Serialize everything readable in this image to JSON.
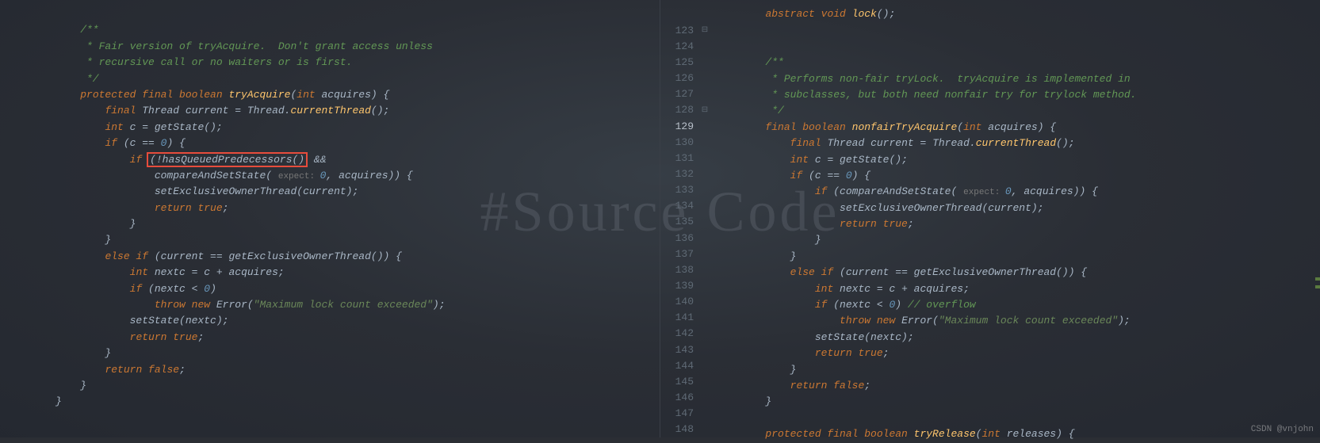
{
  "watermark": "#Source Code",
  "credit": "CSDN @vnjohn",
  "leftPane": {
    "start_line_visible": false,
    "comment": [
      "/**",
      " * Fair version of tryAcquire.  Don't grant access unless",
      " * recursive call or no waiters or is first.",
      " */"
    ],
    "lines": [
      {
        "tokens": [
          [
            "kw",
            "protected final boolean "
          ],
          [
            "method",
            "tryAcquire"
          ],
          [
            "ident",
            "("
          ],
          [
            "kw",
            "int"
          ],
          [
            "ident",
            " acquires) {"
          ]
        ]
      },
      {
        "tokens": [
          [
            "ident",
            "    "
          ],
          [
            "kw",
            "final"
          ],
          [
            "ident",
            " Thread current = Thread."
          ],
          [
            "method",
            "currentThread"
          ],
          [
            "ident",
            "();"
          ]
        ]
      },
      {
        "tokens": [
          [
            "ident",
            "    "
          ],
          [
            "kw",
            "int"
          ],
          [
            "ident",
            " c = getState();"
          ]
        ]
      },
      {
        "tokens": [
          [
            "ident",
            "    "
          ],
          [
            "kw",
            "if"
          ],
          [
            "ident",
            " (c == "
          ],
          [
            "num",
            "0"
          ],
          [
            "ident",
            ") {"
          ]
        ]
      },
      {
        "highlight": true,
        "tokens": [
          [
            "ident",
            "        "
          ],
          [
            "kw",
            "if"
          ],
          [
            "ident",
            " "
          ],
          [
            "redbox",
            "(!hasQueuedPredecessors()"
          ],
          [
            "ident",
            " &&"
          ]
        ]
      },
      {
        "tokens": [
          [
            "ident",
            "            compareAndSetState( "
          ],
          [
            "hint",
            "expect: "
          ],
          [
            "num",
            "0"
          ],
          [
            "ident",
            ", acquires)) {"
          ]
        ]
      },
      {
        "tokens": [
          [
            "ident",
            "            setExclusiveOwnerThread(current);"
          ]
        ]
      },
      {
        "tokens": [
          [
            "ident",
            "            "
          ],
          [
            "kw",
            "return true"
          ],
          [
            "ident",
            ";"
          ]
        ]
      },
      {
        "tokens": [
          [
            "ident",
            "        }"
          ]
        ]
      },
      {
        "tokens": [
          [
            "ident",
            "    }"
          ]
        ]
      },
      {
        "tokens": [
          [
            "ident",
            "    "
          ],
          [
            "kw",
            "else if"
          ],
          [
            "ident",
            " (current == getExclusiveOwnerThread()) {"
          ]
        ]
      },
      {
        "tokens": [
          [
            "ident",
            "        "
          ],
          [
            "kw",
            "int"
          ],
          [
            "ident",
            " nextc = c + acquires;"
          ]
        ]
      },
      {
        "tokens": [
          [
            "ident",
            "        "
          ],
          [
            "kw",
            "if"
          ],
          [
            "ident",
            " (nextc < "
          ],
          [
            "num",
            "0"
          ],
          [
            "ident",
            ")"
          ]
        ]
      },
      {
        "tokens": [
          [
            "ident",
            "            "
          ],
          [
            "kw",
            "throw new"
          ],
          [
            "ident",
            " Error("
          ],
          [
            "str",
            "\"Maximum lock count exceeded\""
          ],
          [
            "ident",
            ");"
          ]
        ]
      },
      {
        "tokens": [
          [
            "ident",
            "        setState(nextc);"
          ]
        ]
      },
      {
        "tokens": [
          [
            "ident",
            "        "
          ],
          [
            "kw",
            "return true"
          ],
          [
            "ident",
            ";"
          ]
        ]
      },
      {
        "tokens": [
          [
            "ident",
            "    }"
          ]
        ]
      },
      {
        "tokens": [
          [
            "ident",
            "    "
          ],
          [
            "kw",
            "return false"
          ],
          [
            "ident",
            ";"
          ]
        ]
      },
      {
        "tokens": [
          [
            "ident",
            "}"
          ]
        ]
      }
    ]
  },
  "rightPane": {
    "line_numbers": [
      123,
      124,
      125,
      126,
      127,
      128,
      129,
      130,
      131,
      132,
      133,
      134,
      135,
      136,
      137,
      138,
      139,
      140,
      141,
      142,
      143,
      144,
      145,
      146,
      147,
      148
    ],
    "current_line": 129,
    "top_line": {
      "tokens": [
        [
          "ident",
          "    "
        ],
        [
          "kw",
          "abstract void "
        ],
        [
          "method",
          "lock"
        ],
        [
          "ident",
          "();"
        ]
      ]
    },
    "comment": [
      "/**",
      " * Performs non-fair tryLock.  tryAcquire is implemented in",
      " * subclasses, but both need nonfair try for trylock method.",
      " */"
    ],
    "lines": [
      {
        "tokens": [
          [
            "kw",
            "final boolean "
          ],
          [
            "method",
            "nonfairTryAcquire"
          ],
          [
            "ident",
            "("
          ],
          [
            "kw",
            "int"
          ],
          [
            "ident",
            " acquires) {"
          ]
        ]
      },
      {
        "tokens": [
          [
            "ident",
            "    "
          ],
          [
            "kw",
            "final"
          ],
          [
            "ident",
            " Thread current = Thread."
          ],
          [
            "method",
            "currentThread"
          ],
          [
            "ident",
            "();"
          ]
        ]
      },
      {
        "tokens": [
          [
            "ident",
            "    "
          ],
          [
            "kw",
            "int"
          ],
          [
            "ident",
            " c = getState();"
          ]
        ]
      },
      {
        "tokens": [
          [
            "ident",
            "    "
          ],
          [
            "kw",
            "if"
          ],
          [
            "ident",
            " (c == "
          ],
          [
            "num",
            "0"
          ],
          [
            "ident",
            ") {"
          ]
        ]
      },
      {
        "tokens": [
          [
            "ident",
            "        "
          ],
          [
            "kw",
            "if"
          ],
          [
            "ident",
            " (compareAndSetState( "
          ],
          [
            "hint",
            "expect: "
          ],
          [
            "num",
            "0"
          ],
          [
            "ident",
            ", acquires)) {"
          ]
        ]
      },
      {
        "tokens": [
          [
            "ident",
            "            setExclusiveOwnerThread(current);"
          ]
        ]
      },
      {
        "tokens": [
          [
            "ident",
            "            "
          ],
          [
            "kw",
            "return true"
          ],
          [
            "ident",
            ";"
          ]
        ]
      },
      {
        "tokens": [
          [
            "ident",
            "        }"
          ]
        ]
      },
      {
        "tokens": [
          [
            "ident",
            "    }"
          ]
        ]
      },
      {
        "tokens": [
          [
            "ident",
            "    "
          ],
          [
            "kw",
            "else if"
          ],
          [
            "ident",
            " (current == getExclusiveOwnerThread()) {"
          ]
        ]
      },
      {
        "tokens": [
          [
            "ident",
            "        "
          ],
          [
            "kw",
            "int"
          ],
          [
            "ident",
            " nextc = c + acquires;"
          ]
        ]
      },
      {
        "tokens": [
          [
            "ident",
            "        "
          ],
          [
            "kw",
            "if"
          ],
          [
            "ident",
            " (nextc < "
          ],
          [
            "num",
            "0"
          ],
          [
            "ident",
            ") "
          ],
          [
            "comm",
            "// overflow"
          ]
        ]
      },
      {
        "tokens": [
          [
            "ident",
            "            "
          ],
          [
            "kw",
            "throw new"
          ],
          [
            "ident",
            " Error("
          ],
          [
            "str",
            "\"Maximum lock count exceeded\""
          ],
          [
            "ident",
            ");"
          ]
        ]
      },
      {
        "tokens": [
          [
            "ident",
            "        setState(nextc);"
          ]
        ]
      },
      {
        "tokens": [
          [
            "ident",
            "        "
          ],
          [
            "kw",
            "return true"
          ],
          [
            "ident",
            ";"
          ]
        ]
      },
      {
        "tokens": [
          [
            "ident",
            "    }"
          ]
        ]
      },
      {
        "tokens": [
          [
            "ident",
            "    "
          ],
          [
            "kw",
            "return false"
          ],
          [
            "ident",
            ";"
          ]
        ]
      },
      {
        "tokens": [
          [
            "ident",
            "}"
          ]
        ]
      }
    ],
    "bottom_line": {
      "tokens": [
        [
          "kw",
          "protected final boolean "
        ],
        [
          "method",
          "tryRelease"
        ],
        [
          "ident",
          "("
        ],
        [
          "kw",
          "int"
        ],
        [
          "ident",
          " releases) {"
        ]
      ]
    }
  }
}
